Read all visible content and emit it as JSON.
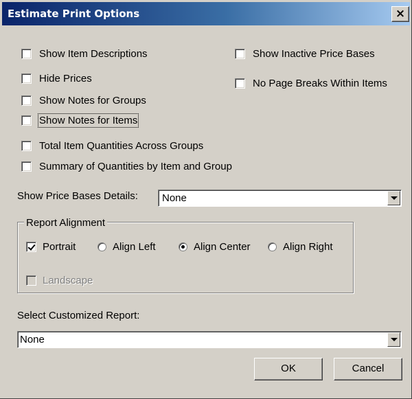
{
  "window": {
    "title": "Estimate Print Options",
    "close_glyph": "×"
  },
  "options": {
    "show_item_descriptions": {
      "label": "Show Item Descriptions",
      "checked": false
    },
    "hide_prices": {
      "label": "Hide Prices",
      "checked": false
    },
    "show_notes_groups": {
      "label": "Show Notes for Groups",
      "checked": false
    },
    "show_notes_items": {
      "label": "Show Notes for Items",
      "checked": false
    },
    "total_item_quantities": {
      "label": "Total Item Quantities Across Groups",
      "checked": false
    },
    "summary_quantities": {
      "label": "Summary of Quantities by Item and Group",
      "checked": false
    },
    "show_inactive_price_bases": {
      "label": "Show Inactive Price Bases",
      "checked": false
    },
    "no_page_breaks": {
      "label": "No Page Breaks Within Items",
      "checked": false
    }
  },
  "price_bases": {
    "label": "Show Price Bases Details:",
    "value": "None"
  },
  "report_alignment": {
    "title": "Report Alignment",
    "portrait": {
      "label": "Portrait",
      "checked": true
    },
    "align_left": {
      "label": "Align Left",
      "selected": false
    },
    "align_center": {
      "label": "Align Center",
      "selected": true
    },
    "align_right": {
      "label": "Align Right",
      "selected": false
    },
    "landscape": {
      "label": "Landscape",
      "checked": false,
      "enabled": false
    }
  },
  "custom_report": {
    "label": "Select Customized Report:",
    "value": "None"
  },
  "buttons": {
    "ok": "OK",
    "cancel": "Cancel"
  },
  "icons": {
    "close": "close-icon",
    "dropdown": "chevron-down-icon"
  }
}
